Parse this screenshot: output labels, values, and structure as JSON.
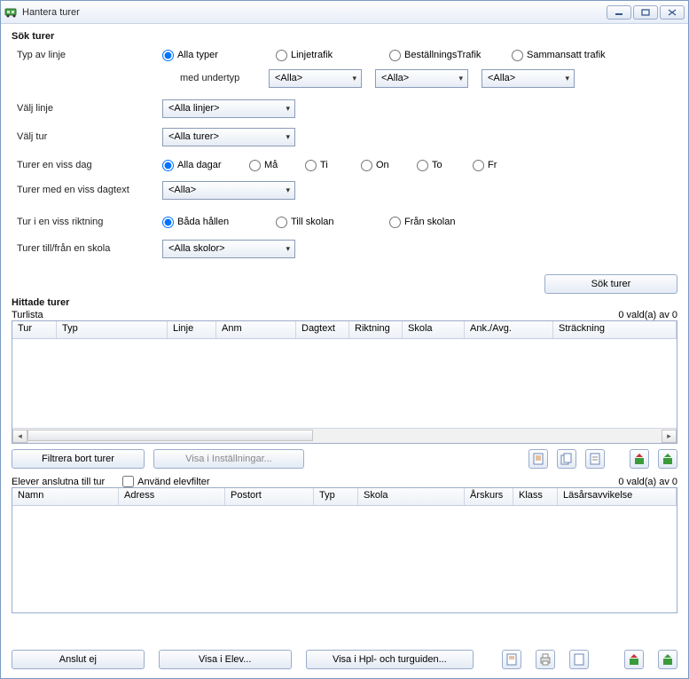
{
  "window": {
    "title": "Hantera turer"
  },
  "search": {
    "title": "Sök turer",
    "typeLabel": "Typ av linje",
    "subtypeLabel": "med undertyp",
    "types": {
      "all": "Alla typer",
      "linje": "Linjetrafik",
      "best": "BeställningsTrafik",
      "samman": "Sammansatt trafik"
    },
    "subtypeValue": "<Alla>",
    "lineLabel": "Välj linje",
    "lineValue": "<Alla linjer>",
    "tourLabel": "Välj tur",
    "tourValue": "<Alla turer>",
    "dayLabel": "Turer en viss dag",
    "days": {
      "all": "Alla dagar",
      "mo": "Må",
      "ti": "Ti",
      "on": "On",
      "to": "To",
      "fr": "Fr"
    },
    "dayTextLabel": "Turer med en viss dagtext",
    "dayTextValue": "<Alla>",
    "dirLabel": "Tur i en viss riktning",
    "dirs": {
      "both": "Båda hållen",
      "to": "Till skolan",
      "from": "Från skolan"
    },
    "schoolLabel": "Turer till/från en skola",
    "schoolValue": "<Alla skolor>",
    "searchBtn": "Sök turer"
  },
  "found": {
    "title": "Hittade turer",
    "listLabel": "Turlista",
    "countText": "0 vald(a) av 0",
    "cols": {
      "tur": "Tur",
      "typ": "Typ",
      "linje": "Linje",
      "anm": "Anm",
      "dagtext": "Dagtext",
      "riktning": "Riktning",
      "skola": "Skola",
      "ankavg": "Ank./Avg.",
      "strackning": "Sträckning"
    },
    "filterBtn": "Filtrera bort turer",
    "showSettingsBtn": "Visa i Inställningar..."
  },
  "students": {
    "title": "Elever anslutna till tur",
    "useFilterLabel": "Använd elevfilter",
    "countText": "0 vald(a) av 0",
    "cols": {
      "namn": "Namn",
      "adress": "Adress",
      "postort": "Postort",
      "typ": "Typ",
      "skola": "Skola",
      "arskurs": "Årskurs",
      "klass": "Klass",
      "lasar": "Läsårsavvikelse"
    }
  },
  "bottom": {
    "dontAttach": "Anslut ej",
    "showInStudent": "Visa i Elev...",
    "showInGuide": "Visa i Hpl- och turguiden..."
  }
}
